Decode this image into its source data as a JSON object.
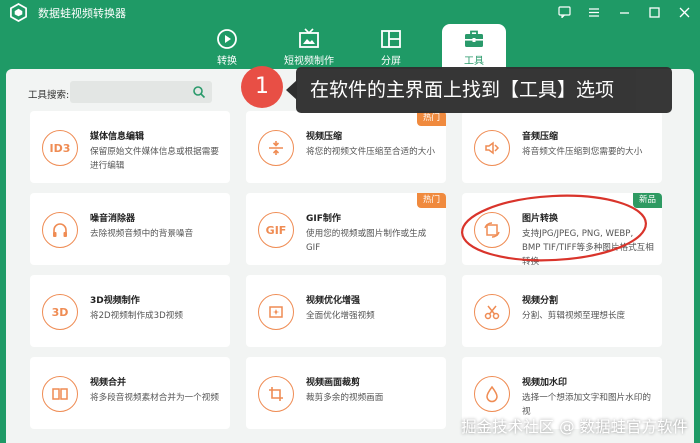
{
  "app": {
    "title": "数据蛙视频转换器"
  },
  "tabs": [
    {
      "label": "转换",
      "icon": "convert-icon"
    },
    {
      "label": "短视频制作",
      "icon": "short-video-icon"
    },
    {
      "label": "分屏",
      "icon": "split-screen-icon"
    },
    {
      "label": "工具",
      "icon": "toolbox-icon",
      "active": true
    }
  ],
  "search": {
    "label": "工具搜索:",
    "value": ""
  },
  "tools": [
    {
      "name": "媒体信息编辑",
      "desc": "保留原始文件媒体信息或根据需要进行编辑",
      "icon": "id3-icon",
      "icon_text": "ID3"
    },
    {
      "name": "视频压缩",
      "desc": "将您的视频文件压缩至合适的大小",
      "icon": "compress-icon",
      "badge": "热门"
    },
    {
      "name": "音频压缩",
      "desc": "将音频文件压缩到您需要的大小",
      "icon": "audio-compress-icon"
    },
    {
      "name": "噪音消除器",
      "desc": "去除视频音频中的背景噪音",
      "icon": "headphones-icon"
    },
    {
      "name": "GIF制作",
      "desc": "使用您的视频或图片制作或生成GIF",
      "icon": "gif-icon",
      "icon_text": "GIF",
      "badge": "热门"
    },
    {
      "name": "图片转换",
      "desc": "支持JPG/JPEG, PNG, WEBP, BMP TIF/TIFF等多种图片格式互相转换",
      "icon": "image-convert-icon",
      "badge": "新品"
    },
    {
      "name": "3D视频制作",
      "desc": "将2D视频制作成3D视频",
      "icon": "3d-icon",
      "icon_text": "3D"
    },
    {
      "name": "视频优化增强",
      "desc": "全面优化增强视频",
      "icon": "enhance-icon"
    },
    {
      "name": "视频分割",
      "desc": "分割、剪辑视频至理想长度",
      "icon": "scissors-icon"
    },
    {
      "name": "视频合并",
      "desc": "将多段音视频素材合并为一个视频",
      "icon": "merge-icon"
    },
    {
      "name": "视频画面裁剪",
      "desc": "裁剪多余的视频画面",
      "icon": "crop-icon"
    },
    {
      "name": "视频加水印",
      "desc": "选择一个想添加文字和图片水印的视",
      "icon": "watermark-drop-icon"
    }
  ],
  "annotation": {
    "step": "1",
    "text": "在软件的主界面上找到【工具】选项"
  },
  "watermark": "掘金技术社区 @ 数据蛙官方软件",
  "colors": {
    "brand_green": "#1f9a66",
    "accent_orange": "#ef8c54",
    "hot_badge": "#f08a3e",
    "new_badge": "#2e9a62",
    "annotation_red": "#e84f45"
  }
}
